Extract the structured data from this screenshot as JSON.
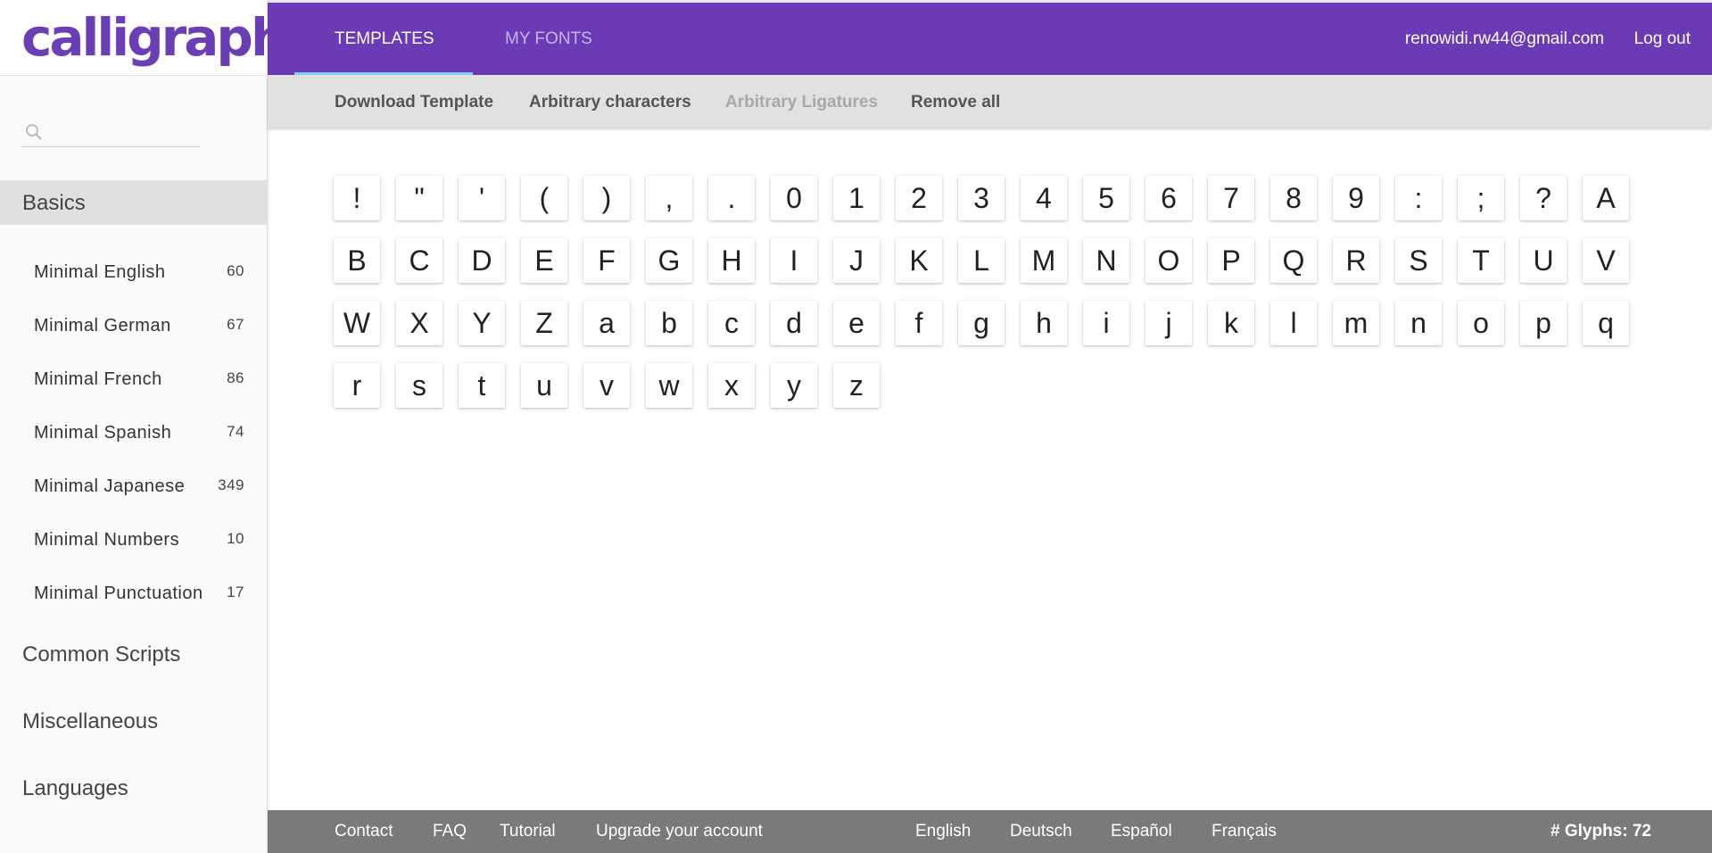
{
  "brand": {
    "logo_text": "calligraphr",
    "accent": "#6a3bb5"
  },
  "sidebar": {
    "search_placeholder": "",
    "sections": [
      {
        "title": "Basics",
        "expanded": true,
        "items": [
          {
            "label": "Minimal English",
            "count": "60"
          },
          {
            "label": "Minimal German",
            "count": "67"
          },
          {
            "label": "Minimal French",
            "count": "86"
          },
          {
            "label": "Minimal Spanish",
            "count": "74"
          },
          {
            "label": "Minimal Japanese",
            "count": "349"
          },
          {
            "label": "Minimal Numbers",
            "count": "10"
          },
          {
            "label": "Minimal Punctuation",
            "count": "17"
          }
        ]
      },
      {
        "title": "Common Scripts"
      },
      {
        "title": "Miscellaneous"
      },
      {
        "title": "Languages"
      }
    ]
  },
  "header": {
    "tabs": [
      {
        "label": "TEMPLATES",
        "active": true
      },
      {
        "label": "MY FONTS",
        "active": false
      }
    ],
    "user_email": "renowidi.rw44@gmail.com",
    "logout_label": "Log out"
  },
  "toolbar": {
    "download_label": "Download Template",
    "arbitrary_chars_label": "Arbitrary characters",
    "arbitrary_ligatures_label": "Arbitrary Ligatures",
    "remove_all_label": "Remove all"
  },
  "glyphs": [
    "!",
    "\"",
    "'",
    "(",
    ")",
    ",",
    ".",
    "0",
    "1",
    "2",
    "3",
    "4",
    "5",
    "6",
    "7",
    "8",
    "9",
    ":",
    ";",
    "?",
    "A",
    "B",
    "C",
    "D",
    "E",
    "F",
    "G",
    "H",
    "I",
    "J",
    "K",
    "L",
    "M",
    "N",
    "O",
    "P",
    "Q",
    "R",
    "S",
    "T",
    "U",
    "V",
    "W",
    "X",
    "Y",
    "Z",
    "a",
    "b",
    "c",
    "d",
    "e",
    "f",
    "g",
    "h",
    "i",
    "j",
    "k",
    "l",
    "m",
    "n",
    "o",
    "p",
    "q",
    "r",
    "s",
    "t",
    "u",
    "v",
    "w",
    "x",
    "y",
    "z"
  ],
  "footer": {
    "contact": "Contact",
    "faq": "FAQ",
    "tutorial": "Tutorial",
    "upgrade": "Upgrade your account",
    "lang_en": "English",
    "lang_de": "Deutsch",
    "lang_es": "Español",
    "lang_fr": "Français",
    "glyph_count_label": "# Glyphs:",
    "glyph_count": "72"
  }
}
